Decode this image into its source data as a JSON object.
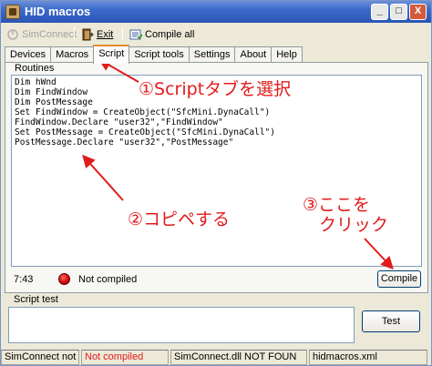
{
  "window": {
    "title": "HID macros"
  },
  "titlebar_buttons": {
    "minimize": "_",
    "maximize": "□",
    "close": "X"
  },
  "toolbar": {
    "simconnect_label": "SimConnect",
    "exit_label": "Exit",
    "compile_all_label": "Compile all"
  },
  "tabs": [
    {
      "label": "Devices"
    },
    {
      "label": "Macros"
    },
    {
      "label": "Script"
    },
    {
      "label": "Script tools"
    },
    {
      "label": "Settings"
    },
    {
      "label": "About"
    },
    {
      "label": "Help"
    }
  ],
  "routines": {
    "group_label": "Routines",
    "code_lines": [
      "Dim hWnd",
      "Dim FindWindow",
      "Dim PostMessage",
      "Set FindWindow = CreateObject(\"SfcMini.DynaCall\")",
      "FindWindow.Declare \"user32\",\"FindWindow\"",
      "Set PostMessage = CreateObject(\"SfcMini.DynaCall\")",
      "PostMessage.Declare \"user32\",\"PostMessage\""
    ]
  },
  "status": {
    "cursor_pos": "7:43",
    "compile_status": "Not compiled",
    "compile_button": "Compile"
  },
  "script_test": {
    "group_label": "Script test",
    "test_button": "Test"
  },
  "statusbar": {
    "panel1": "SimConnect not",
    "panel2": "Not compiled",
    "panel3": "SimConnect.dll NOT FOUN",
    "panel4": "hidmacros.xml"
  },
  "annotations": {
    "step1": "①Scriptタブを選択",
    "step2": "②コピペする",
    "step3_line1": "③ここを",
    "step3_line2": "クリック"
  },
  "colors": {
    "annotation": "#e11b1b",
    "not_compiled": "#e11b1b",
    "active_tab_accent": "#e68b2c",
    "titlebar": "#2a55b6"
  }
}
